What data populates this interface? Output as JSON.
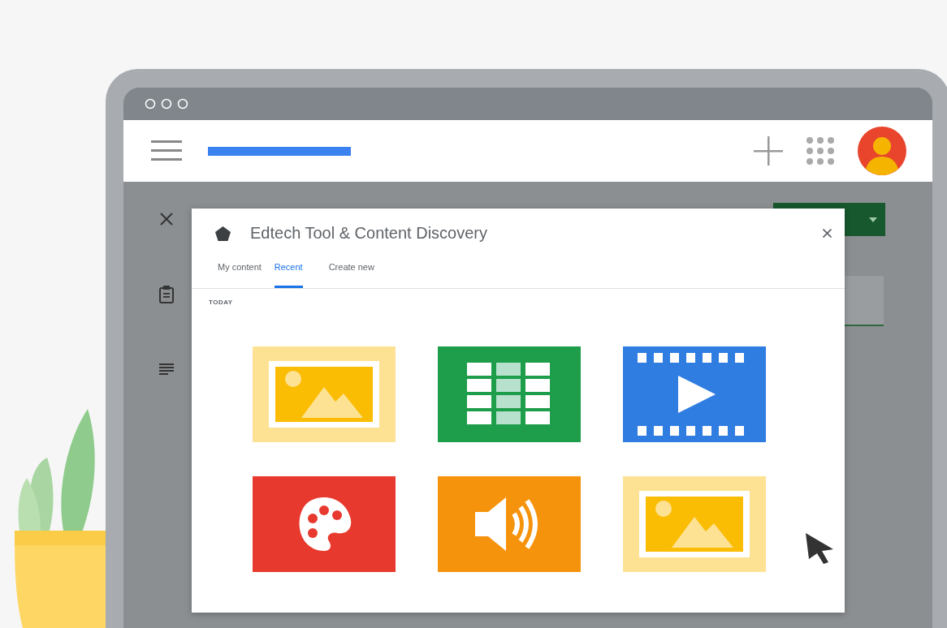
{
  "dialog": {
    "title": "Edtech Tool & Content Discovery",
    "tabs": [
      {
        "label": "My content",
        "selected": false
      },
      {
        "label": "Recent",
        "selected": true
      },
      {
        "label": "Create new",
        "selected": false
      }
    ],
    "section_label": "TODAY",
    "tiles": [
      {
        "kind": "image"
      },
      {
        "kind": "spreadsheet"
      },
      {
        "kind": "video"
      },
      {
        "kind": "palette"
      },
      {
        "kind": "audio"
      },
      {
        "kind": "image"
      }
    ]
  }
}
